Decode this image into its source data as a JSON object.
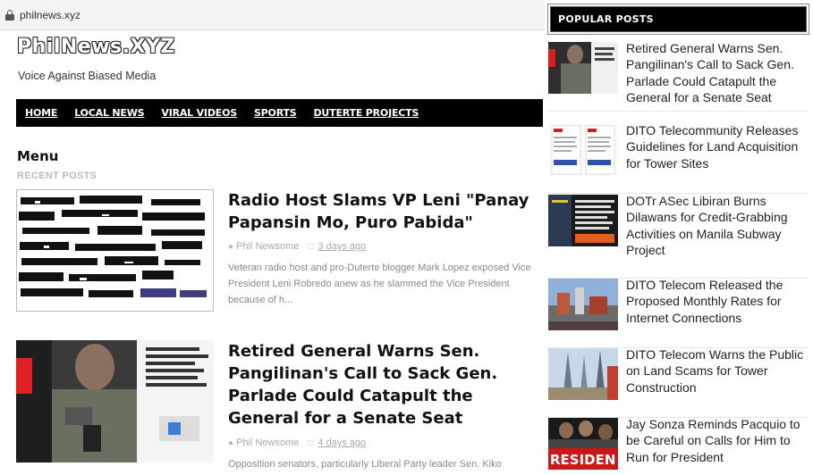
{
  "browser": {
    "url": "philnews.xyz"
  },
  "site": {
    "title": "PhilNews.XYZ",
    "tagline": "Voice Against Biased Media"
  },
  "nav": {
    "items": [
      "HOME",
      "LOCAL NEWS",
      "VIRAL VIDEOS",
      "SPORTS",
      "DUTERTE PROJECTS"
    ]
  },
  "main": {
    "menu_heading": "Menu",
    "recent_label": "RECENT POSTS",
    "posts": [
      {
        "title": "Radio Host Slams VP Leni \"Panay Papansin Mo, Puro Pabida\"",
        "author": "Phil Newsome",
        "date": "3 days ago",
        "excerpt": "Veteran radio host and pro-Duterte blogger Mark Lopez exposed Vice President Leni Robredo anew as he slammed the Vice President because of h..."
      },
      {
        "title": "Retired General Warns Sen. Pangilinan's Call to Sack Gen. Parlade Could Catapult the General for a Senate Seat",
        "author": "Phil Newsome",
        "date": "4 days ago",
        "excerpt": "Opposition senators, particularly Liberal Party leader Sen. Kiko"
      }
    ]
  },
  "sidebar": {
    "title": "POPULAR POSTS",
    "items": [
      {
        "title": "Retired General Warns Sen. Pangilinan's Call to Sack Gen. Parlade Could Catapult the General for a Senate Seat"
      },
      {
        "title": "DITO Telecommunity Releases Guidelines for Land Acquisition for Tower Sites"
      },
      {
        "title": "DOTr ASec Libiran Burns Dilawans for Credit-Grabbing Activities on Manila Subway Project"
      },
      {
        "title": "DITO Telecom Released the Proposed Monthly Rates for Internet Connections"
      },
      {
        "title": "DITO Telecom Warns the Public on Land Scams for Tower Construction"
      },
      {
        "title": "Jay Sonza Reminds Pacquio to be Careful on Calls for Him to Run for President"
      }
    ],
    "thumb_texts": {
      "item6": "RESIDEN"
    }
  },
  "colors": {
    "nav_bg": "#000000",
    "title_text": "#111111",
    "meta_text": "#aaaaaa",
    "accent": "#000000"
  }
}
